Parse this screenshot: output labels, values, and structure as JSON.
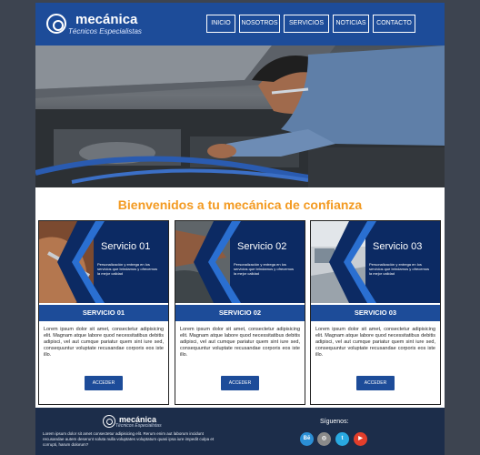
{
  "header": {
    "brand": "mecánica",
    "tagline": "Técnicos Especialistas",
    "nav": [
      "INICIO",
      "NOSOTROS",
      "SERVICIOS",
      "NOTICIAS",
      "CONTACTO"
    ]
  },
  "welcome": "Bienvenidos a tu mecánica de confianza",
  "services": [
    {
      "title": "Servicio 01",
      "subtitle": "Personalización y entrega en los servicios que brindamos y ofrecemos la mejor calidad",
      "band": "SERVICIO 01",
      "text": "Lorem ipsum dolor sit amet, consectetur adipisicing elit. Magnam atque labore quod necessitatibus debitis adipisci, vel aut cumque pariatur quem sint iure sed, consequuntur voluptate recusandae corporis eos iste illo.",
      "button": "ACCEDER"
    },
    {
      "title": "Servicio 02",
      "subtitle": "Personalización y entrega en los servicios que brindamos y ofrecemos la mejor calidad",
      "band": "SERVICIO 02",
      "text": "Lorem ipsum dolor sit amet, consectetur adipisicing elit. Magnam atque labore quod necessitatibus debitis adipisci, vel aut cumque pariatur quem sint iure sed, consequuntur voluptate recusandae corporis eos iste illo.",
      "button": "ACCEDER"
    },
    {
      "title": "Servicio 03",
      "subtitle": "Personalización y entrega en los servicios que brindamos y ofrecemos la mejor calidad",
      "band": "SERVICIO 03",
      "text": "Lorem ipsum dolor sit amet, consectetur adipisicing elit. Magnam atque labore quod necessitatibus debitis adipisci, vel aut cumque pariatur quem sint iure sed, consequuntur voluptate recusandae corporis eos iste illo.",
      "button": "ACCEDER"
    }
  ],
  "footer": {
    "brand": "mecánica",
    "tagline": "Técnicos Especialistas",
    "text": "Lorem ipsum dolor sit amet consectetur adipisicing elit. Rerum enim aut laborum incidunt recusandae autem deserunt soluta nulla voluptates voluptatum quasi ipsa iure impedit culpa et corrupti, harum dolorum?",
    "follow": "Síguenos:",
    "social": [
      {
        "name": "behance-icon",
        "glyph": "Bē"
      },
      {
        "name": "instagram-icon",
        "glyph": "◎"
      },
      {
        "name": "twitter-icon",
        "glyph": "t"
      },
      {
        "name": "youtube-icon",
        "glyph": "▶"
      }
    ]
  },
  "colors": {
    "primary": "#1d4c99",
    "accent": "#f39a21",
    "footer": "#1c2d4a",
    "background": "#3d4450"
  }
}
